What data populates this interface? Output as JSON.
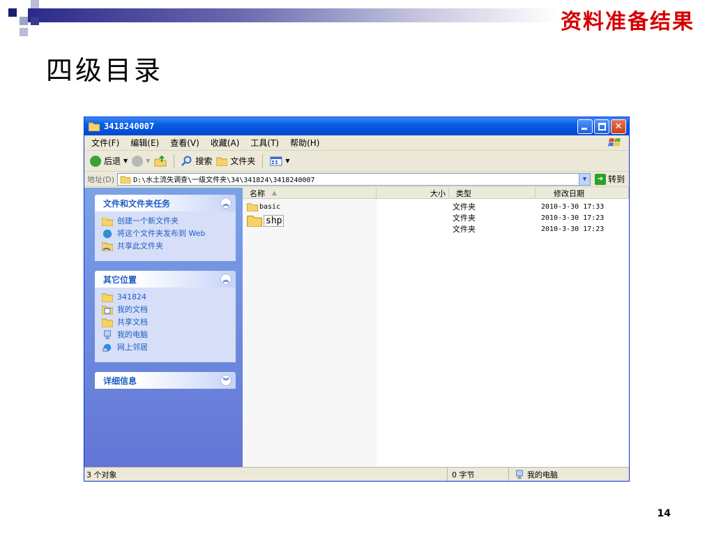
{
  "slide": {
    "corner_title": "资料准备结果",
    "title": "四级目录",
    "page_number": "14"
  },
  "window": {
    "title": "3418240007",
    "menu": [
      "文件(F)",
      "编辑(E)",
      "查看(V)",
      "收藏(A)",
      "工具(T)",
      "帮助(H)"
    ],
    "toolbar": {
      "back": "后退",
      "search": "搜索",
      "folders": "文件夹"
    },
    "address": {
      "label": "地址(D)",
      "path": "D:\\水土流失调查\\一级文件夹\\34\\341824\\3418240007",
      "go": "转到"
    },
    "task_panels": [
      {
        "title": "文件和文件夹任务",
        "items": [
          {
            "icon": "new-folder-icon",
            "label": "创建一个新文件夹"
          },
          {
            "icon": "publish-web-icon",
            "label": "将这个文件夹发布到 Web"
          },
          {
            "icon": "share-folder-icon",
            "label": "共享此文件夹"
          }
        ]
      },
      {
        "title": "其它位置",
        "items": [
          {
            "icon": "folder-icon",
            "label": "341824"
          },
          {
            "icon": "my-documents-icon",
            "label": "我的文档"
          },
          {
            "icon": "folder-icon",
            "label": "共享文档"
          },
          {
            "icon": "my-computer-icon",
            "label": "我的电脑"
          },
          {
            "icon": "network-places-icon",
            "label": "网上邻居"
          }
        ]
      },
      {
        "title": "详细信息",
        "items": []
      }
    ],
    "columns": {
      "name": "名称",
      "size": "大小",
      "type": "类型",
      "modified": "修改日期"
    },
    "files": [
      {
        "name": "basic",
        "type": "文件夹",
        "modified": "2010-3-30 17:33"
      },
      {
        "name": "shp",
        "type": "文件夹",
        "modified": "2010-3-30 17:23"
      },
      {
        "name": "",
        "type": "文件夹",
        "modified": "2010-3-30 17:23"
      }
    ],
    "status": {
      "objects": "3 个对象",
      "size": "0 字节",
      "location": "我的电脑"
    }
  }
}
